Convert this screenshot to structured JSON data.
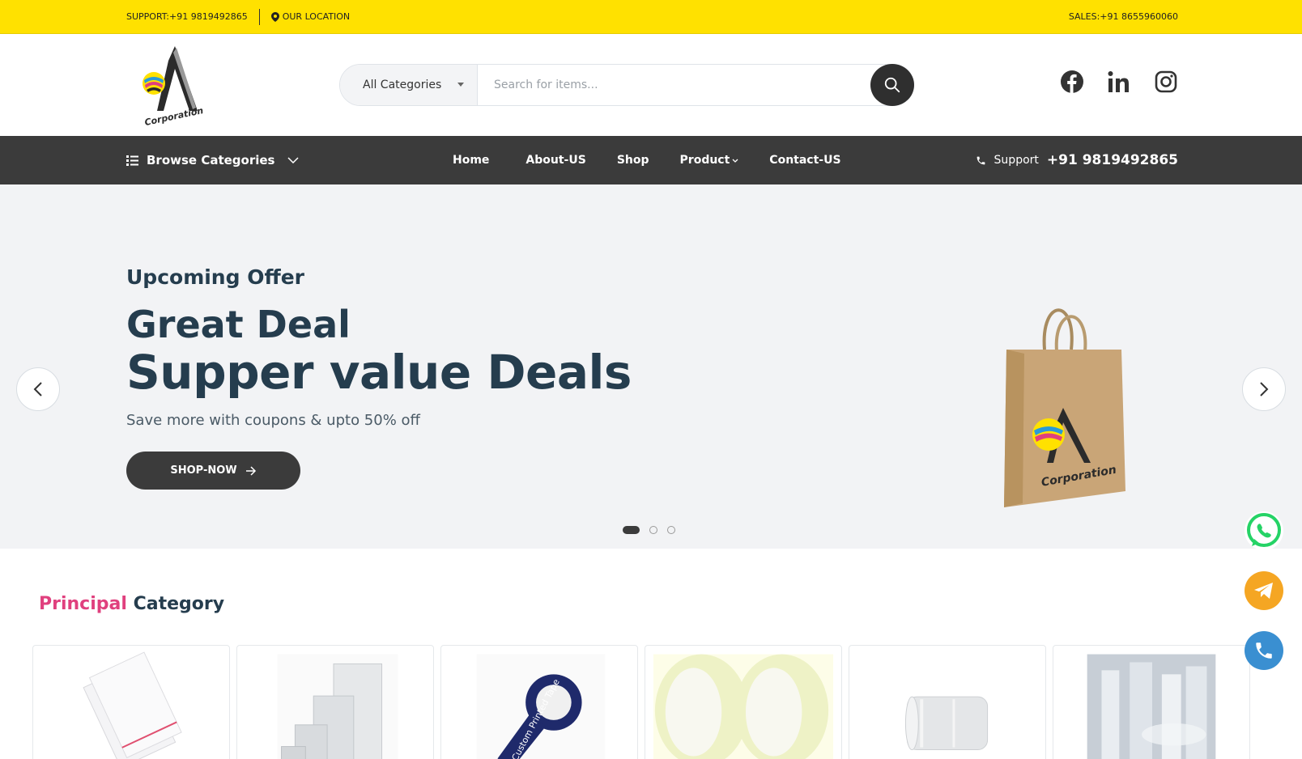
{
  "topbar": {
    "support": "SUPPORT:+91 9819492865",
    "location": "OUR LOCATION",
    "sales": "SALES:+91 8655960060"
  },
  "header": {
    "logo_icon": "corporation-logo",
    "category_select": "All Categories",
    "search_placeholder": "Search for items...",
    "search_icon": "search-icon",
    "socials": [
      "facebook-icon",
      "linkedin-icon",
      "instagram-icon"
    ]
  },
  "nav": {
    "browse_label": "Browse Categories",
    "items": [
      {
        "label": "Home"
      },
      {
        "label": "About-US"
      },
      {
        "label": "Shop"
      },
      {
        "label": "Product"
      },
      {
        "label": "Contact-US"
      }
    ],
    "support_label": "Support",
    "support_number": "+91 9819492865"
  },
  "hero": {
    "pre_title": "Upcoming Offer",
    "title_line1": "Great Deal",
    "title_line2": "Supper value Deals",
    "subtitle": "Save more with coupons & upto 50% off",
    "cta_label": "SHOP-NOW",
    "slide_index": 1,
    "slide_count": 3
  },
  "section": {
    "title_accent": "Principal",
    "title_rest": "Category"
  },
  "categories": [
    {
      "name": "bopp-bags-image"
    },
    {
      "name": "ziplock-bags-image"
    },
    {
      "name": "custom-printed-tape-image"
    },
    {
      "name": "transparent-tape-image"
    },
    {
      "name": "stretch-film-roll-image"
    },
    {
      "name": "plastic-film-rolls-image"
    }
  ],
  "floating": [
    "whatsapp-icon",
    "telegram-icon",
    "phone-icon"
  ],
  "colors": {
    "topbar": "#ffe100",
    "nav": "#3b3b3b",
    "accent": "#e0407e",
    "whatsapp": "#25d366",
    "telegram": "#f5a623",
    "phone": "#3a8fd1"
  }
}
